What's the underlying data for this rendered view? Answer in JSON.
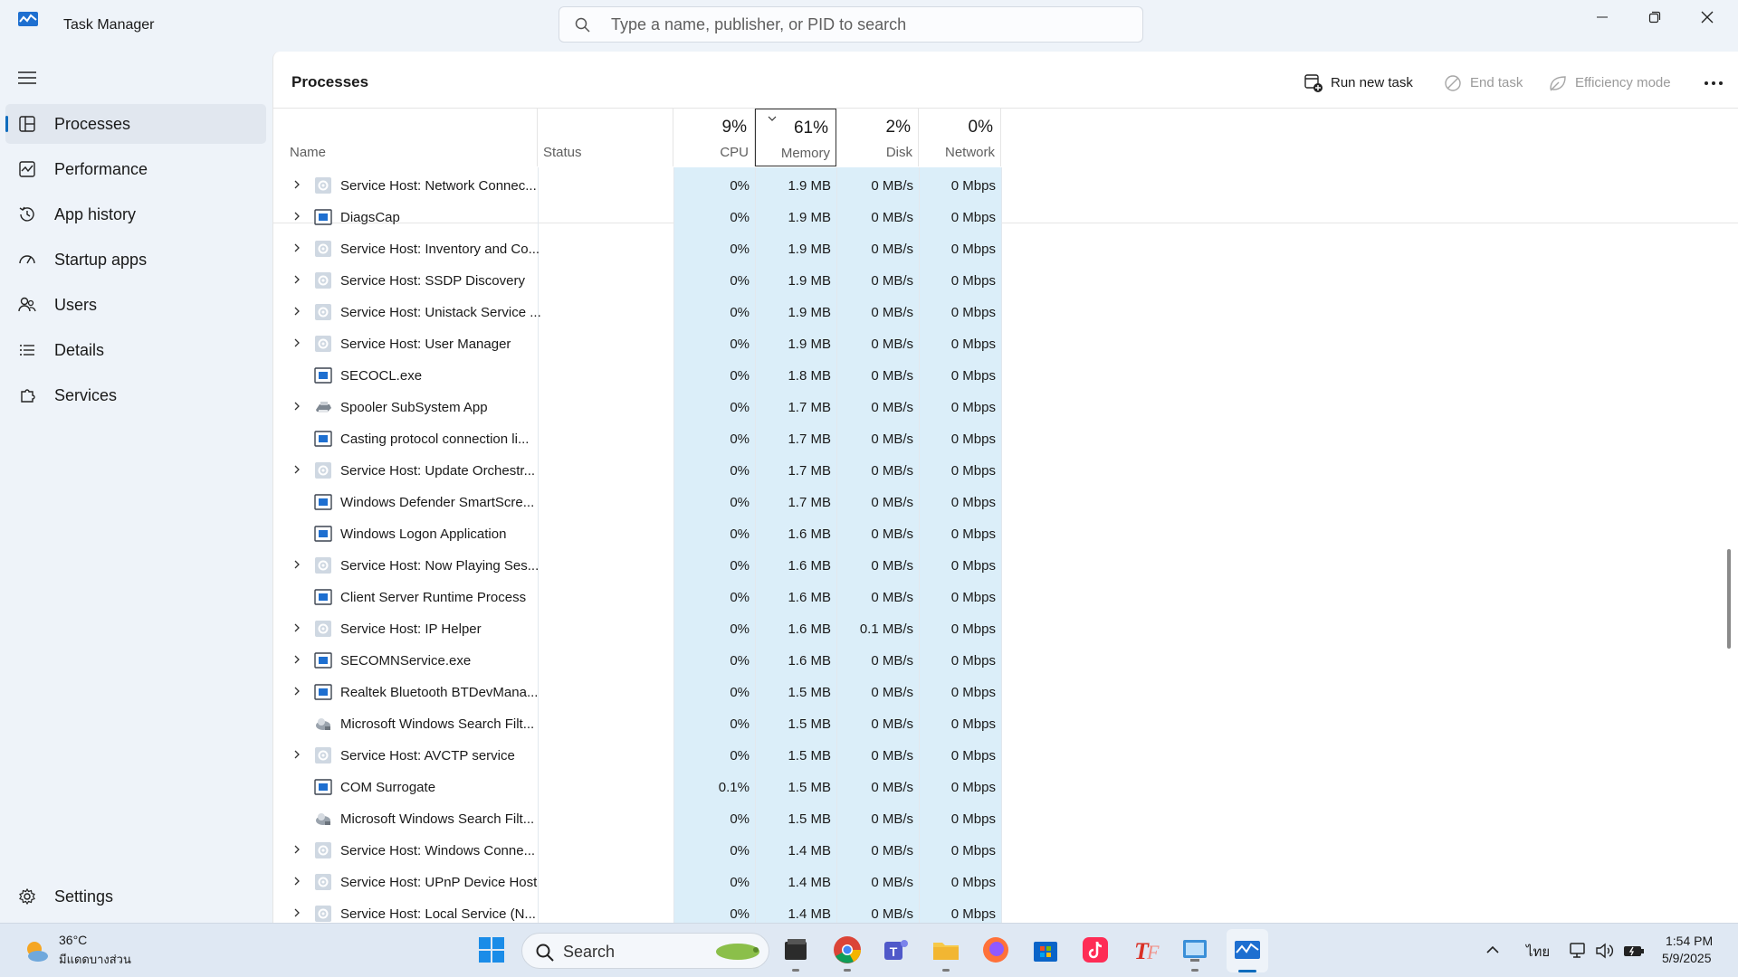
{
  "window": {
    "title": "Task Manager"
  },
  "search": {
    "placeholder": "Type a name, publisher, or PID to search"
  },
  "sidebar": {
    "items": [
      {
        "label": "Processes",
        "icon": "processes-grid-icon"
      },
      {
        "label": "Performance",
        "icon": "performance-graph-icon"
      },
      {
        "label": "App history",
        "icon": "history-icon"
      },
      {
        "label": "Startup apps",
        "icon": "startup-speedometer-icon"
      },
      {
        "label": "Users",
        "icon": "users-icon"
      },
      {
        "label": "Details",
        "icon": "list-details-icon"
      },
      {
        "label": "Services",
        "icon": "services-puzzle-icon"
      }
    ],
    "settings_label": "Settings"
  },
  "main": {
    "title": "Processes",
    "toolbar": {
      "run_new_task": "Run new task",
      "end_task": "End task",
      "efficiency_mode": "Efficiency mode"
    }
  },
  "columns": {
    "name": "Name",
    "status": "Status",
    "cpu": {
      "label": "CPU",
      "pct": "9%"
    },
    "memory": {
      "label": "Memory",
      "pct": "61%"
    },
    "disk": {
      "label": "Disk",
      "pct": "2%"
    },
    "network": {
      "label": "Network",
      "pct": "0%"
    }
  },
  "processes": [
    {
      "name": "Service Host: Network Connec...",
      "expandable": true,
      "icon": "gear",
      "cpu": "0%",
      "memory": "1.9 MB",
      "disk": "0 MB/s",
      "network": "0 Mbps"
    },
    {
      "name": "DiagsCap",
      "expandable": true,
      "icon": "window",
      "cpu": "0%",
      "memory": "1.9 MB",
      "disk": "0 MB/s",
      "network": "0 Mbps"
    },
    {
      "name": "Service Host: Inventory and Co...",
      "expandable": true,
      "icon": "gear",
      "cpu": "0%",
      "memory": "1.9 MB",
      "disk": "0 MB/s",
      "network": "0 Mbps"
    },
    {
      "name": "Service Host: SSDP Discovery",
      "expandable": true,
      "icon": "gear",
      "cpu": "0%",
      "memory": "1.9 MB",
      "disk": "0 MB/s",
      "network": "0 Mbps"
    },
    {
      "name": "Service Host: Unistack Service ...",
      "expandable": true,
      "icon": "gear",
      "cpu": "0%",
      "memory": "1.9 MB",
      "disk": "0 MB/s",
      "network": "0 Mbps"
    },
    {
      "name": "Service Host: User Manager",
      "expandable": true,
      "icon": "gear",
      "cpu": "0%",
      "memory": "1.9 MB",
      "disk": "0 MB/s",
      "network": "0 Mbps"
    },
    {
      "name": "SECOCL.exe",
      "expandable": false,
      "icon": "window",
      "cpu": "0%",
      "memory": "1.8 MB",
      "disk": "0 MB/s",
      "network": "0 Mbps"
    },
    {
      "name": "Spooler SubSystem App",
      "expandable": true,
      "icon": "printer",
      "cpu": "0%",
      "memory": "1.7 MB",
      "disk": "0 MB/s",
      "network": "0 Mbps"
    },
    {
      "name": "Casting protocol connection li...",
      "expandable": false,
      "icon": "window",
      "cpu": "0%",
      "memory": "1.7 MB",
      "disk": "0 MB/s",
      "network": "0 Mbps"
    },
    {
      "name": "Service Host: Update Orchestr...",
      "expandable": true,
      "icon": "gear",
      "cpu": "0%",
      "memory": "1.7 MB",
      "disk": "0 MB/s",
      "network": "0 Mbps"
    },
    {
      "name": "Windows Defender SmartScre...",
      "expandable": false,
      "icon": "window",
      "cpu": "0%",
      "memory": "1.7 MB",
      "disk": "0 MB/s",
      "network": "0 Mbps"
    },
    {
      "name": "Windows Logon Application",
      "expandable": false,
      "icon": "window",
      "cpu": "0%",
      "memory": "1.6 MB",
      "disk": "0 MB/s",
      "network": "0 Mbps"
    },
    {
      "name": "Service Host: Now Playing Ses...",
      "expandable": true,
      "icon": "gear",
      "cpu": "0%",
      "memory": "1.6 MB",
      "disk": "0 MB/s",
      "network": "0 Mbps"
    },
    {
      "name": "Client Server Runtime Process",
      "expandable": false,
      "icon": "window",
      "cpu": "0%",
      "memory": "1.6 MB",
      "disk": "0 MB/s",
      "network": "0 Mbps"
    },
    {
      "name": "Service Host: IP Helper",
      "expandable": true,
      "icon": "gear",
      "cpu": "0%",
      "memory": "1.6 MB",
      "disk": "0.1 MB/s",
      "network": "0 Mbps"
    },
    {
      "name": "SECOMNService.exe",
      "expandable": true,
      "icon": "window",
      "cpu": "0%",
      "memory": "1.6 MB",
      "disk": "0 MB/s",
      "network": "0 Mbps"
    },
    {
      "name": "Realtek Bluetooth BTDevMana...",
      "expandable": true,
      "icon": "window",
      "cpu": "0%",
      "memory": "1.5 MB",
      "disk": "0 MB/s",
      "network": "0 Mbps"
    },
    {
      "name": "Microsoft Windows Search Filt...",
      "expandable": false,
      "icon": "search-filter",
      "cpu": "0%",
      "memory": "1.5 MB",
      "disk": "0 MB/s",
      "network": "0 Mbps"
    },
    {
      "name": "Service Host: AVCTP service",
      "expandable": true,
      "icon": "gear",
      "cpu": "0%",
      "memory": "1.5 MB",
      "disk": "0 MB/s",
      "network": "0 Mbps"
    },
    {
      "name": "COM Surrogate",
      "expandable": false,
      "icon": "window",
      "cpu": "0.1%",
      "memory": "1.5 MB",
      "disk": "0 MB/s",
      "network": "0 Mbps"
    },
    {
      "name": "Microsoft Windows Search Filt...",
      "expandable": false,
      "icon": "search-filter",
      "cpu": "0%",
      "memory": "1.5 MB",
      "disk": "0 MB/s",
      "network": "0 Mbps"
    },
    {
      "name": "Service Host: Windows Conne...",
      "expandable": true,
      "icon": "gear",
      "cpu": "0%",
      "memory": "1.4 MB",
      "disk": "0 MB/s",
      "network": "0 Mbps"
    },
    {
      "name": "Service Host: UPnP Device Host",
      "expandable": true,
      "icon": "gear",
      "cpu": "0%",
      "memory": "1.4 MB",
      "disk": "0 MB/s",
      "network": "0 Mbps"
    },
    {
      "name": "Service Host: Local Service (N...",
      "expandable": true,
      "icon": "gear",
      "cpu": "0%",
      "memory": "1.4 MB",
      "disk": "0 MB/s",
      "network": "0 Mbps"
    }
  ],
  "taskbar": {
    "weather": {
      "temp": "36°C",
      "desc": "มีแดดบางส่วน"
    },
    "search_label": "Search",
    "apps": [
      "windows-start-icon",
      "file-explorer-dark-icon",
      "chrome-icon",
      "teams-icon",
      "folder-icon",
      "firefox-icon",
      "store-icon",
      "tiktok-icon",
      "text-app-icon",
      "control-panel-icon",
      "task-manager-icon"
    ],
    "language": "ไทย",
    "time": "1:54 PM",
    "date": "5/9/2025"
  },
  "colors": {
    "accent": "#0f6cbd",
    "column_tint": "#dbeef9",
    "sidebar_bg": "#eef3f9"
  }
}
